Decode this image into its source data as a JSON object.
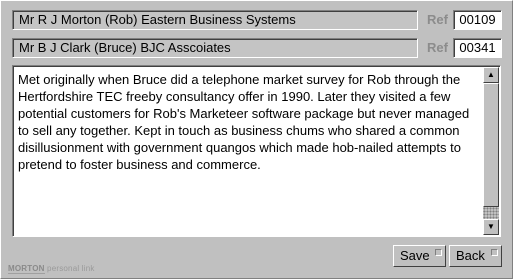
{
  "contacts": [
    {
      "name": "Mr R J Morton (Rob)  Eastern Business Systems",
      "ref_label": "Ref",
      "ref_value": "00109"
    },
    {
      "name": "Mr B J Clark (Bruce)  BJC Asscoiates",
      "ref_label": "Ref",
      "ref_value": "00341"
    }
  ],
  "notes": {
    "text": "Met originally when Bruce did a telephone market survey for Rob through the\nHertfordshire TEC freeby consultancy offer in 1990. Later they visited a few\npotential customers for Rob's Marketeer software package but never managed\nto sell any together. Kept in touch as business chums who shared a common\ndisillusionment with government quangos which made hob-nailed attempts to\npretend to foster business and commerce."
  },
  "scrollbar": {
    "up_icon": "up-arrow-icon",
    "down_icon": "down-arrow-icon"
  },
  "buttons": {
    "save": "Save",
    "back": "Back"
  },
  "footer": {
    "brand": "MORTON",
    "product": "personal link"
  }
}
